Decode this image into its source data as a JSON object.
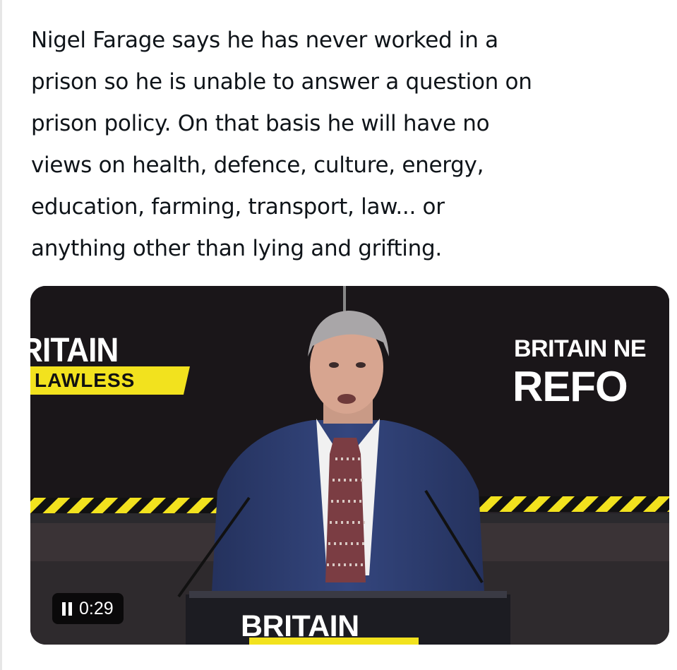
{
  "post": {
    "lines": [
      "Nigel Farage says he has never worked in a",
      "prison so he is unable to answer a question on",
      "prison policy. On that basis he will have no",
      "views on health, defence, culture, energy,",
      "education, farming, transport, law... or",
      "anything other than lying and grifting."
    ]
  },
  "video": {
    "left_sign_top": "RITAIN",
    "left_sign_bottom": "LAWLESS",
    "right_sign_top": "BRITAIN NE",
    "right_sign_bottom": "REFO",
    "podium_text": "BRITAIN",
    "timestamp": "0:29",
    "control_icon": "pause-icon"
  },
  "colors": {
    "text": "#0f1419",
    "backdrop": "#15121a",
    "hazard_yellow": "#f2e21e",
    "suit": "#2b3a6b",
    "podium": "#1c1c22"
  }
}
